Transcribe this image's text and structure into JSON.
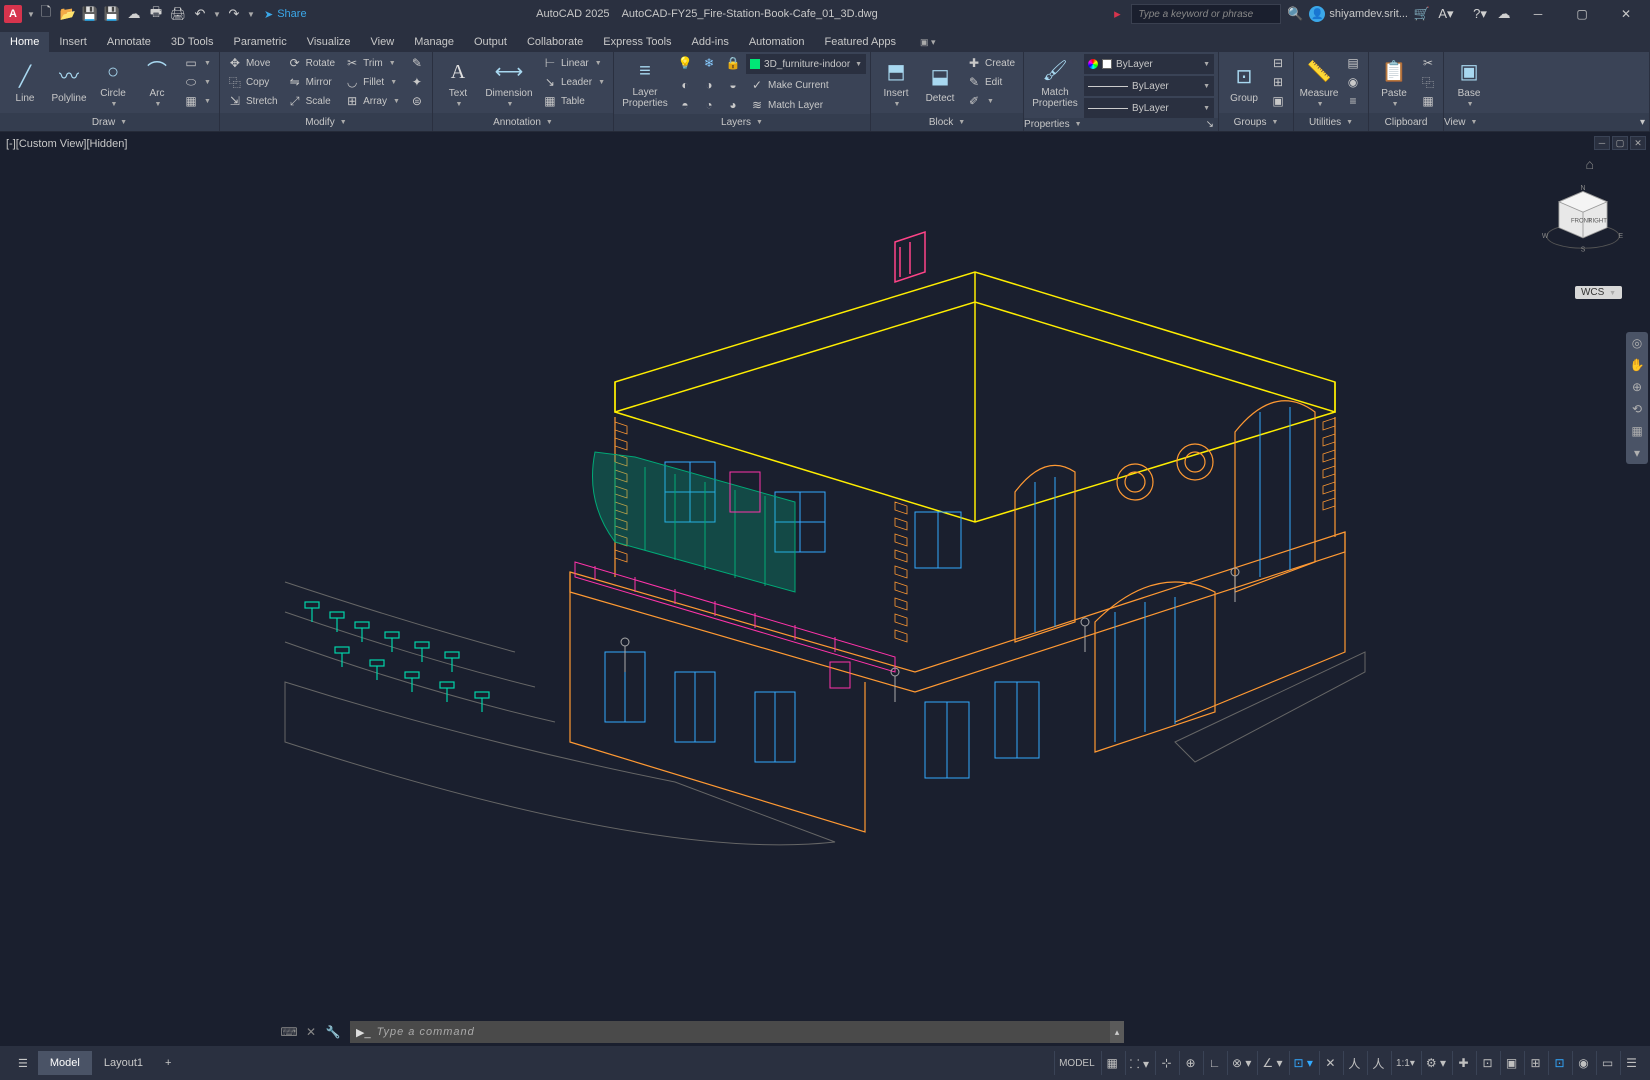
{
  "title": {
    "app": "AutoCAD 2025",
    "file": "AutoCAD-FY25_Fire-Station-Book-Cafe_01_3D.dwg"
  },
  "share_label": "Share",
  "search": {
    "placeholder": "Type a keyword or phrase"
  },
  "user": {
    "name": "shiyamdev.srit..."
  },
  "tabs": [
    "Home",
    "Insert",
    "Annotate",
    "3D Tools",
    "Parametric",
    "Visualize",
    "View",
    "Manage",
    "Output",
    "Collaborate",
    "Express Tools",
    "Add-ins",
    "Automation",
    "Featured Apps"
  ],
  "active_tab": 0,
  "ribbon": {
    "draw": {
      "title": "Draw",
      "items": [
        "Line",
        "Polyline",
        "Circle",
        "Arc"
      ]
    },
    "modify": {
      "title": "Modify",
      "rows": [
        [
          "Move",
          "Rotate",
          "Trim"
        ],
        [
          "Copy",
          "Mirror",
          "Fillet"
        ],
        [
          "Stretch",
          "Scale",
          "Array"
        ]
      ]
    },
    "annotation": {
      "title": "Annotation",
      "big": [
        "Text",
        "Dimension"
      ],
      "small": [
        "Linear",
        "Leader",
        "Table"
      ]
    },
    "layers": {
      "title": "Layers",
      "big": "Layer\nProperties",
      "current": "3D_furniture-indoor",
      "small": [
        "Make Current",
        "Match Layer"
      ]
    },
    "block": {
      "title": "Block",
      "big": [
        "Insert",
        "Detect"
      ],
      "small": [
        "Create",
        "Edit"
      ]
    },
    "properties": {
      "title": "Properties",
      "big": "Match\nProperties",
      "bylayer": "ByLayer"
    },
    "groups": {
      "title": "Groups",
      "big": "Group"
    },
    "utilities": {
      "title": "Utilities",
      "big": "Measure"
    },
    "clipboard": {
      "title": "Clipboard",
      "big": "Paste"
    },
    "view": {
      "title": "View",
      "big": "Base"
    }
  },
  "viewport": {
    "label": "[-][Custom View][Hidden]",
    "wcs": "WCS",
    "cube_front": "FRONT",
    "cube_right": "RIGHT",
    "compass": {
      "n": "N",
      "e": "E",
      "s": "S",
      "w": "W"
    }
  },
  "command": {
    "placeholder": "Type a command"
  },
  "status": {
    "model": "Model",
    "layout": "Layout1",
    "model_label": "MODEL",
    "scale": "1:1"
  }
}
